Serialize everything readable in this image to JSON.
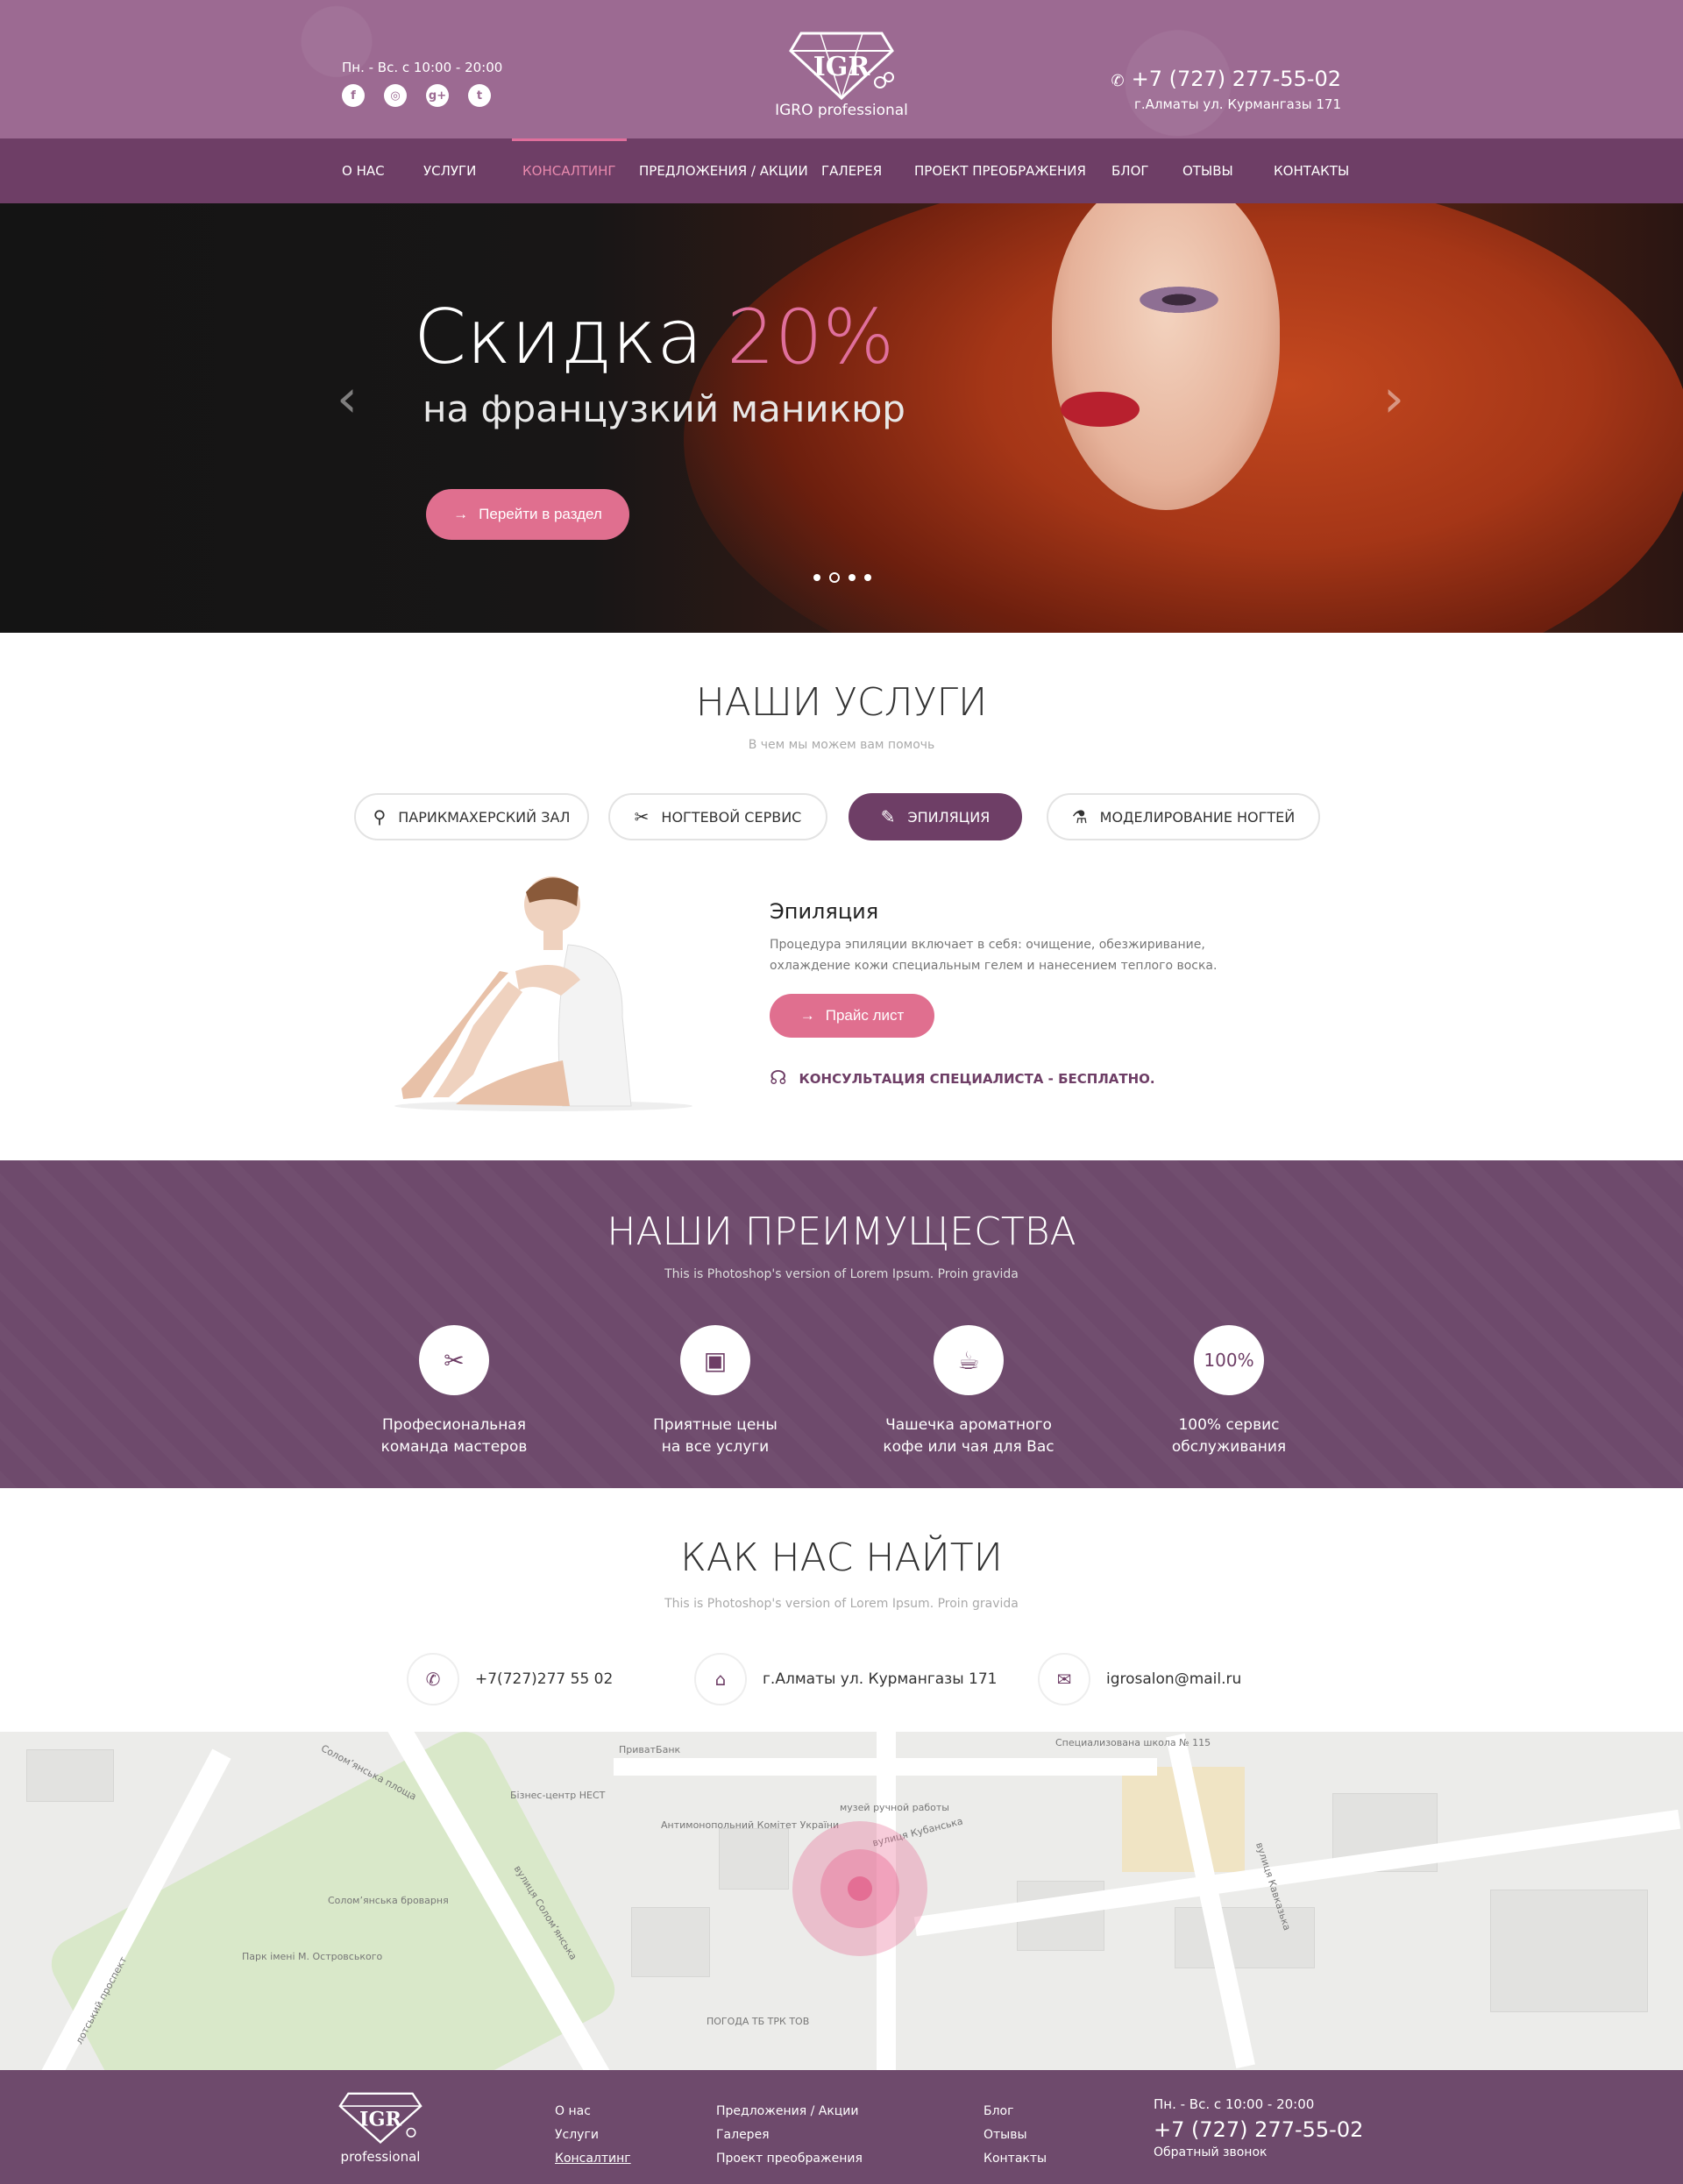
{
  "header": {
    "hours": "Пн. - Вс. с 10:00 - 20:00",
    "socials": [
      {
        "name": "facebook",
        "glyph": "f"
      },
      {
        "name": "instagram",
        "glyph": "◎"
      },
      {
        "name": "google-plus",
        "glyph": "g+"
      },
      {
        "name": "twitter",
        "glyph": "t"
      }
    ],
    "logo_text": "IGRO professional",
    "phone": "+7 (727) 277-55-02",
    "address": "г.Алматы ул. Курмангазы 171"
  },
  "nav": {
    "items": [
      {
        "label": "О НАС",
        "active": false
      },
      {
        "label": "УСЛУГИ",
        "active": false
      },
      {
        "label": "КОНСАЛТИНГ",
        "active": true
      },
      {
        "label": "ПРЕДЛОЖЕНИЯ / АКЦИИ",
        "active": false
      },
      {
        "label": "ГАЛЕРЕЯ",
        "active": false
      },
      {
        "label": "ПРОЕКТ ПРЕОБРАЖЕНИЯ",
        "active": false
      },
      {
        "label": "БЛОГ",
        "active": false
      },
      {
        "label": "ОТЫВЫ",
        "active": false
      },
      {
        "label": "КОНТАКТЫ",
        "active": false
      }
    ]
  },
  "hero": {
    "title": "Скидка",
    "title_pct": "20%",
    "subtitle": "на французкий маникюр",
    "button": "Перейти в раздел",
    "active_slide": 2,
    "slide_count": 4
  },
  "services": {
    "title": "НАШИ УСЛУГИ",
    "subtitle": "В чем мы можем вам помочь",
    "tabs": [
      {
        "label": "ПАРИКМАХЕРСКИЙ ЗАЛ",
        "icon": "mirror-icon",
        "glyph": "⚲",
        "active": false
      },
      {
        "label": "НОГТЕВОЙ СЕРВИС",
        "icon": "scissors-icon",
        "glyph": "✂",
        "active": false
      },
      {
        "label": "ЭПИЛЯЦИЯ",
        "icon": "razor-icon",
        "glyph": "✎",
        "active": true
      },
      {
        "label": "МОДЕЛИРОВАНИЕ НОГТЕЙ",
        "icon": "nail-polish-icon",
        "glyph": "⚗",
        "active": false
      }
    ],
    "detail_title": "Эпиляция",
    "detail_desc": "Процедура эпиляции включает в себя: очищение, обезжиривание, охлаждение кожи специальным гелем и нанесением теплого воска.",
    "price_button": "Прайс лист",
    "consult": "КОНСУЛЬТАЦИЯ СПЕЦИАЛИСТА - БЕСПЛАТНО."
  },
  "advantages": {
    "title": "НАШИ ПРЕИМУЩЕСТВА",
    "subtitle": "This is Photoshop's version  of Lorem Ipsum. Proin gravida",
    "items": [
      {
        "icon": "scissors-icon",
        "glyph": "✂",
        "line1": "Професиональная",
        "line2": "команда мастеров"
      },
      {
        "icon": "wallet-icon",
        "glyph": "▣",
        "line1": "Приятные цены",
        "line2": "на все услуги"
      },
      {
        "icon": "coffee-cup-icon",
        "glyph": "☕",
        "line1": "Чашечка ароматного",
        "line2": "кофе или чая для Вас"
      },
      {
        "icon": "percent-badge",
        "glyph": "100%",
        "line1": "100% сервис",
        "line2": "обслуживания"
      }
    ]
  },
  "find": {
    "title": "КАК НАС НАЙТИ",
    "subtitle": "This is Photoshop's version  of Lorem Ipsum. Proin gravida",
    "phone": "+7(727)277 55 02",
    "address": "г.Алматы ул. Курмангазы 171",
    "email": "igrosalon@mail.ru"
  },
  "map": {
    "labels": [
      "Соломʼянська броварня",
      "Парк імені М. Островського",
      "вулиця Соломʼянська",
      "Соломʼянська площа",
      "Бізнес-центр НЕСТ",
      "Антимонопольний Комітет України",
      "ПриватБанк",
      "вулиця Кубанська",
      "Специализована школа № 115",
      "вулиця Кавказька",
      "ПОГОДА ТБ ТРК ТОВ",
      "музей ручной работы",
      "лотський проспект"
    ]
  },
  "footer": {
    "logo_text": "professional",
    "col1": [
      "О нас",
      "Услуги",
      "Консалтинг"
    ],
    "col2": [
      "Предложения / Акции",
      "Галерея",
      "Проект преображения"
    ],
    "col3": [
      "Блог",
      "Отывы",
      "Контакты"
    ],
    "hours": "Пн. - Вс. с 10:00 - 20:00",
    "phone": "+7 (727) 277-55-02",
    "callback": "Обратный звонок"
  }
}
